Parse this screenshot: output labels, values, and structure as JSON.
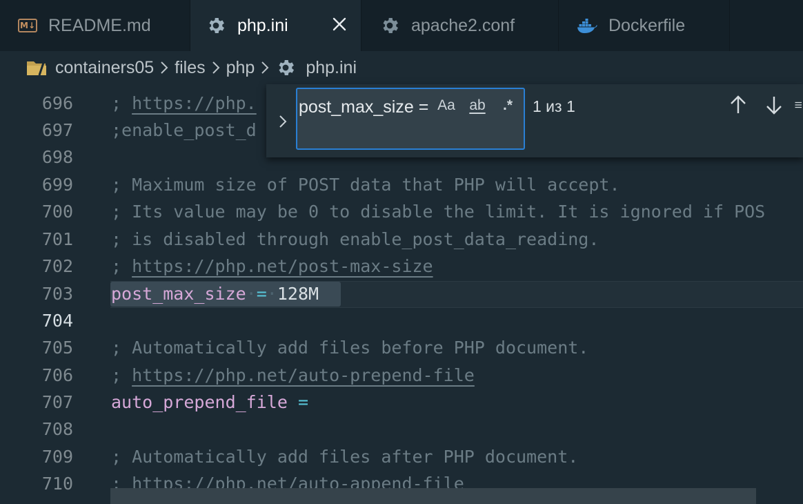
{
  "tabs": [
    {
      "label": "README.md",
      "icon": "markdown-icon",
      "icon_text": "M↓",
      "active": false
    },
    {
      "label": "php.ini",
      "icon": "gear-icon",
      "active": true
    },
    {
      "label": "apache2.conf",
      "icon": "gear-icon",
      "active": false
    },
    {
      "label": "Dockerfile",
      "icon": "docker-icon",
      "active": false
    }
  ],
  "breadcrumb": {
    "folder": "containers05",
    "sub1": "files",
    "sub2": "php",
    "file": "php.ini"
  },
  "find": {
    "query": "post_max_size =",
    "match_case_label": "Aa",
    "whole_word_label": "ab",
    "regex_label": ".*",
    "result": "1 из 1"
  },
  "lines": [
    {
      "num": "696",
      "text": "; https://php."
    },
    {
      "num": "697",
      "text": ";enable_post_d"
    },
    {
      "num": "698",
      "text": ""
    },
    {
      "num": "699",
      "text": "; Maximum size of POST data that PHP will accept."
    },
    {
      "num": "700",
      "text": "; Its value may be 0 to disable the limit. It is ignored if POS"
    },
    {
      "num": "701",
      "text": "; is disabled through enable_post_data_reading."
    },
    {
      "num": "702",
      "prefix": "; ",
      "url": "https://php.net/post-max-size"
    },
    {
      "num": "703",
      "key": "post_max_size",
      "eq": "=",
      "value": "128M"
    },
    {
      "num": "704",
      "text": ""
    },
    {
      "num": "705",
      "text": "; Automatically add files before PHP document."
    },
    {
      "num": "706",
      "prefix": "; ",
      "url": "https://php.net/auto-prepend-file"
    },
    {
      "num": "707",
      "key": "auto_prepend_file",
      "eq": "="
    },
    {
      "num": "708",
      "text": ""
    },
    {
      "num": "709",
      "text": "; Automatically add files after PHP document."
    },
    {
      "num": "710",
      "prefix": "; ",
      "url": "https://php.net/auto-append-file"
    }
  ],
  "colors": {
    "editor_bg": "#1c2a33",
    "tabbar_bg": "#142028",
    "comment": "#6b7c85",
    "key": "#d6a8d8",
    "operator": "#57c3d6",
    "focus_border": "#2a7fd4"
  }
}
